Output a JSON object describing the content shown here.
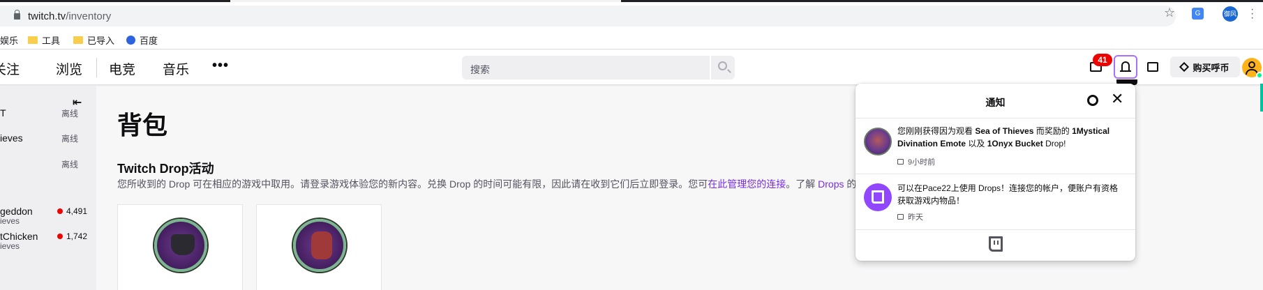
{
  "browser": {
    "url_host": "twitch.tv",
    "url_path": "/inventory",
    "profile_label": "御风"
  },
  "bookmarks": [
    {
      "label": "娱乐",
      "icon": "none"
    },
    {
      "label": "工具",
      "icon": "folder-icon"
    },
    {
      "label": "已导入",
      "icon": "folder-icon"
    },
    {
      "label": "百度",
      "icon": "baidu-paw-icon"
    }
  ],
  "twitch_nav": {
    "items": [
      "关注",
      "浏览",
      "电竞",
      "音乐"
    ],
    "more": "•••",
    "search_placeholder": "搜索",
    "inbox_badge": "41",
    "buy_bits": "购买呼币"
  },
  "sidebar": {
    "channels": [
      {
        "name": "T",
        "status": "离线",
        "game": "",
        "viewers": ""
      },
      {
        "name": "ieves",
        "status": "离线",
        "game": "",
        "viewers": ""
      },
      {
        "name": "",
        "status": "离线",
        "game": "",
        "viewers": ""
      },
      {
        "name": "geddon",
        "status": "",
        "game": "ieves",
        "viewers": "4,491"
      },
      {
        "name": "tChicken",
        "status": "",
        "game": "ieves",
        "viewers": "1,742"
      }
    ]
  },
  "main": {
    "title": "背包",
    "section_title": "Twitch Drop活动",
    "desc_before": "您所收到的 Drop 可在相应的游戏中取用。请登录游戏体验您的新内容。兑换 Drop 的时间可能有限，因此请在收到它们后立即登录。您可",
    "desc_link1": "在此管理您的连接",
    "desc_middle": "。了解 ",
    "desc_link2": "Drops",
    "desc_after": " 的"
  },
  "notifications": {
    "title": "通知",
    "items": [
      {
        "text_1": "您刚刚获得因为观看 ",
        "bold_1": "Sea of Thieves",
        "text_2": " 而奖励的 ",
        "bold_2": "1Mystical Divination Emote",
        "text_3": " 以及 ",
        "bold_3": "1Onyx Bucket",
        "text_4": " Drop!",
        "time": "9小时前"
      },
      {
        "text": "可以在Pace22上使用 Drops！连接您的帐户，便账户有资格获取游戏内物品！",
        "time": "昨天"
      }
    ]
  },
  "colors": {
    "twitch_purple": "#9147ff",
    "link_purple": "#772ce8",
    "live_red": "#eb0400"
  }
}
